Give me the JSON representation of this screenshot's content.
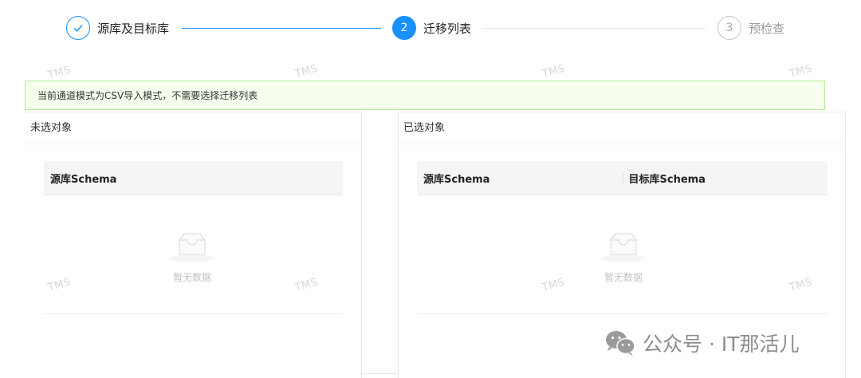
{
  "steps": [
    {
      "index": "1",
      "title": "源库及目标库",
      "status": "done"
    },
    {
      "index": "2",
      "title": "迁移列表",
      "status": "active"
    },
    {
      "index": "3",
      "title": "预检查",
      "status": "wait"
    }
  ],
  "watermark_text": "TMS",
  "alert_text": "当前通道模式为CSV导入模式，不需要选择迁移列表",
  "left_panel": {
    "title": "未选对象",
    "columns": [
      "源库Schema"
    ],
    "empty_text": "暂无数据"
  },
  "right_panel": {
    "title": "已选对象",
    "columns": [
      "源库Schema",
      "目标库Schema"
    ],
    "empty_text": "暂无数据"
  },
  "brand": {
    "text": "公众号 · IT那活儿"
  },
  "colors": {
    "primary": "#1890ff",
    "alert_bg": "#f6ffed",
    "alert_border": "#b7eb8f"
  },
  "icons": {
    "step1": "check-icon",
    "empty": "inbox-icon",
    "brand": "wechat-icon"
  }
}
